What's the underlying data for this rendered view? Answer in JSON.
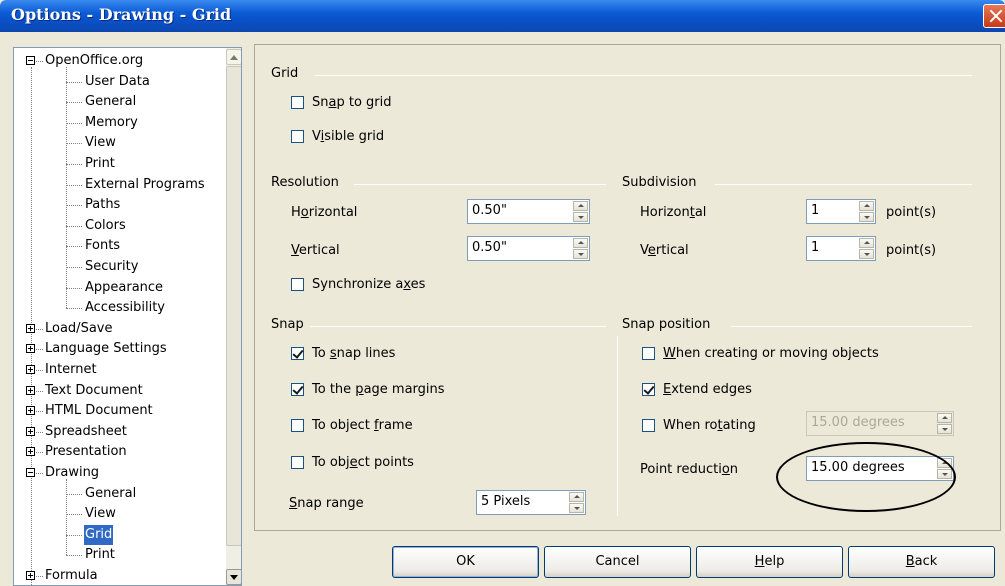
{
  "window": {
    "title": "Options - Drawing - Grid"
  },
  "tree": {
    "items": [
      {
        "label": "OpenOffice.org",
        "state": "expanded"
      },
      {
        "label": "User Data"
      },
      {
        "label": "General"
      },
      {
        "label": "Memory"
      },
      {
        "label": "View"
      },
      {
        "label": "Print"
      },
      {
        "label": "External Programs"
      },
      {
        "label": "Paths"
      },
      {
        "label": "Colors"
      },
      {
        "label": "Fonts"
      },
      {
        "label": "Security"
      },
      {
        "label": "Appearance"
      },
      {
        "label": "Accessibility"
      },
      {
        "label": "Load/Save",
        "state": "collapsed"
      },
      {
        "label": "Language Settings",
        "state": "collapsed"
      },
      {
        "label": "Internet",
        "state": "collapsed"
      },
      {
        "label": "Text Document",
        "state": "collapsed"
      },
      {
        "label": "HTML Document",
        "state": "collapsed"
      },
      {
        "label": "Spreadsheet",
        "state": "collapsed"
      },
      {
        "label": "Presentation",
        "state": "collapsed"
      },
      {
        "label": "Drawing",
        "state": "expanded"
      },
      {
        "label": "General"
      },
      {
        "label": "View"
      },
      {
        "label": "Grid",
        "selected": true
      },
      {
        "label": "Print"
      },
      {
        "label": "Formula",
        "state": "collapsed"
      }
    ]
  },
  "grid": {
    "title": "Grid",
    "snap_to_grid": {
      "pre": "Sn",
      "u": "a",
      "post": "p to grid",
      "checked": false
    },
    "visible_grid": {
      "pre": "V",
      "u": "i",
      "post": "sible grid",
      "checked": false
    }
  },
  "resolution": {
    "title": "Resolution",
    "horizontal": {
      "pre": "H",
      "u": "o",
      "post": "rizontal",
      "value": "0.50\""
    },
    "vertical": {
      "pre": "",
      "u": "V",
      "post": "ertical",
      "value": "0.50\""
    },
    "synchronize": {
      "pre": "Synchronize a",
      "u": "x",
      "post": "es",
      "checked": false
    }
  },
  "subdivision": {
    "title": "Subdivision",
    "horizontal": {
      "pre": "Horizon",
      "u": "t",
      "post": "al",
      "value": "1",
      "unit": "point(s)"
    },
    "vertical": {
      "pre": "V",
      "u": "e",
      "post": "rtical",
      "value": "1",
      "unit": "point(s)"
    }
  },
  "snap": {
    "title": "Snap",
    "snap_lines": {
      "pre": "To ",
      "u": "s",
      "post": "nap lines",
      "checked": true
    },
    "page_margins": {
      "pre": "To the ",
      "u": "p",
      "post": "age margins",
      "checked": true
    },
    "object_frame": {
      "pre": "To object ",
      "u": "f",
      "post": "rame",
      "checked": false
    },
    "object_points": {
      "pre": "To obj",
      "u": "e",
      "post": "ct points",
      "checked": false
    },
    "range": {
      "pre": "",
      "u": "S",
      "post": "nap range",
      "value": "5 Pixels"
    }
  },
  "snap_position": {
    "title": "Snap position",
    "creating_moving": {
      "pre": "",
      "u": "W",
      "post": "hen creating or moving objects",
      "checked": false
    },
    "extend_edges": {
      "pre": "",
      "u": "E",
      "post": "xtend edges",
      "checked": true
    },
    "when_rotating": {
      "pre": "When ro",
      "u": "t",
      "post": "ating",
      "checked": false,
      "value": "15.00 degrees"
    },
    "point_reduction": {
      "pre": "Point reducti",
      "u": "o",
      "post": "n",
      "value": "15.00 degrees"
    }
  },
  "buttons": {
    "ok": "OK",
    "cancel": "Cancel",
    "help": {
      "pre": "",
      "u": "H",
      "post": "elp"
    },
    "back": {
      "pre": "",
      "u": "B",
      "post": "ack"
    }
  }
}
